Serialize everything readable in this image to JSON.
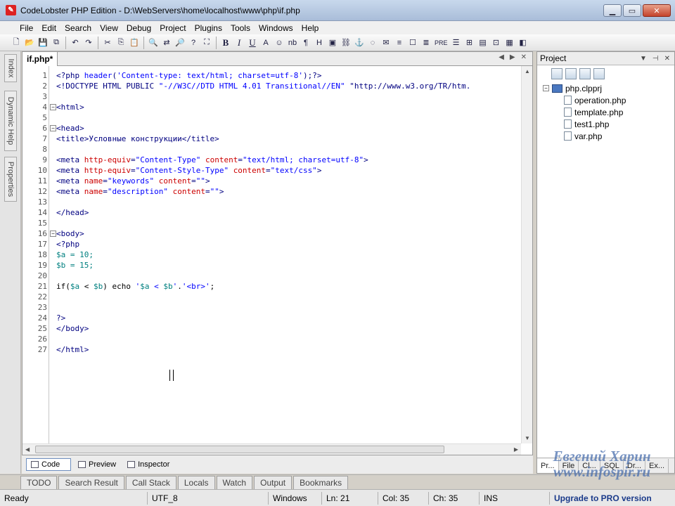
{
  "window": {
    "title": "CodeLobster PHP Edition - D:\\WebServers\\home\\localhost\\www\\php\\if.php"
  },
  "menu": [
    "File",
    "Edit",
    "Search",
    "View",
    "Debug",
    "Project",
    "Plugins",
    "Tools",
    "Windows",
    "Help"
  ],
  "toolbar": {
    "icons": [
      "new-icon",
      "open-icon",
      "save-icon",
      "save-all-icon",
      "undo-icon",
      "redo-icon",
      "cut-icon",
      "copy-icon",
      "paste-icon",
      "find-icon",
      "replace-icon",
      "find-in-files-icon",
      "help-icon",
      "fullscreen-icon",
      "bold-icon",
      "italic-icon",
      "underline-icon",
      "font-icon",
      "color-icon",
      "nbsp-icon",
      "paragraph-icon",
      "heading-icon",
      "image-icon",
      "link-icon",
      "anchor-icon",
      "comment-icon",
      "email-icon",
      "list-icon",
      "table-icon",
      "form-icon",
      "preview-icon",
      "frame-icon"
    ],
    "bold": "B",
    "italic": "I",
    "underline": "U",
    "font": "A",
    "nbsp": "nb",
    "paragraph": "¶",
    "heading": "H",
    "pre": "PRE"
  },
  "left_panel_tabs": [
    "Index",
    "Dynamic Help",
    "Properties"
  ],
  "editor": {
    "file_tab": "if.php*",
    "lines": [
      {
        "n": "1",
        "text": "<?php header('Content-type: text/html; charset=utf-8');?>"
      },
      {
        "n": "2",
        "text": "<!DOCTYPE HTML PUBLIC \"-//W3C//DTD HTML 4.01 Transitional//EN\" \"http://www.w3.org/TR/htm."
      },
      {
        "n": "3",
        "text": ""
      },
      {
        "n": "4",
        "text": "<html>"
      },
      {
        "n": "5",
        "text": ""
      },
      {
        "n": "6",
        "text": "<head>"
      },
      {
        "n": "7",
        "text": "<title>Условные конструкции</title>"
      },
      {
        "n": "8",
        "text": ""
      },
      {
        "n": "9",
        "text": "<meta http-equiv=\"Content-Type\" content=\"text/html; charset=utf-8\">"
      },
      {
        "n": "10",
        "text": "<meta http-equiv=\"Content-Style-Type\" content=\"text/css\">"
      },
      {
        "n": "11",
        "text": "<meta name=\"keywords\" content=\"\">"
      },
      {
        "n": "12",
        "text": "<meta name=\"description\" content=\"\">"
      },
      {
        "n": "13",
        "text": ""
      },
      {
        "n": "14",
        "text": "</head>"
      },
      {
        "n": "15",
        "text": ""
      },
      {
        "n": "16",
        "text": "<body>"
      },
      {
        "n": "17",
        "text": "<?php"
      },
      {
        "n": "18",
        "text": "$a = 10;"
      },
      {
        "n": "19",
        "text": "$b = 15;"
      },
      {
        "n": "20",
        "text": ""
      },
      {
        "n": "21",
        "text": "if($a < $b) echo '$a < $b'.'<br>';"
      },
      {
        "n": "22",
        "text": ""
      },
      {
        "n": "23",
        "text": ""
      },
      {
        "n": "24",
        "text": "?>"
      },
      {
        "n": "25",
        "text": "</body>"
      },
      {
        "n": "26",
        "text": ""
      },
      {
        "n": "27",
        "text": "</html>"
      }
    ]
  },
  "view_tabs": [
    "Code",
    "Preview",
    "Inspector"
  ],
  "project": {
    "title": "Project",
    "root": "php.clpprj",
    "files": [
      "operation.php",
      "template.php",
      "test1.php",
      "var.php"
    ],
    "tabs": [
      "Pr...",
      "File",
      "Cl...",
      "SQL",
      "Dr...",
      "Ex..."
    ]
  },
  "bottom_tabs": [
    "TODO",
    "Search Result",
    "Call Stack",
    "Locals",
    "Watch",
    "Output",
    "Bookmarks"
  ],
  "status": {
    "ready": "Ready",
    "encoding": "UTF_8",
    "line_endings": "Windows",
    "ln": "Ln: 21",
    "col": "Col: 35",
    "ch": "Ch: 35",
    "ins": "INS",
    "upgrade": "Upgrade to PRO version"
  },
  "watermark": {
    "name": "Евгений Харин",
    "site": "www.infospir.ru"
  }
}
